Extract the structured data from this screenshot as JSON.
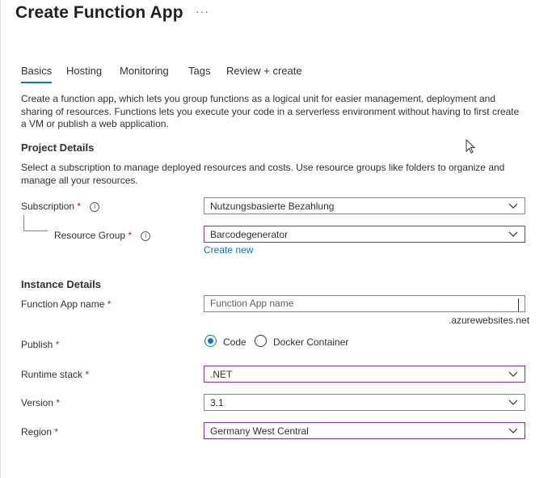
{
  "page": {
    "title": "Create Function App",
    "more": "···"
  },
  "tabs": [
    {
      "label": "Basics",
      "active": true
    },
    {
      "label": "Hosting",
      "active": false
    },
    {
      "label": "Monitoring",
      "active": false
    },
    {
      "label": "Tags",
      "active": false
    },
    {
      "label": "Review + create",
      "active": false
    }
  ],
  "intro": "Create a function app, which lets you group functions as a logical unit for easier management, deployment and sharing of resources. Functions lets you execute your code in a serverless environment without having to first create a VM or publish a web application.",
  "project": {
    "heading": "Project Details",
    "description": "Select a subscription to manage deployed resources and costs. Use resource groups like folders to organize and manage all your resources.",
    "subscription": {
      "label": "Subscription",
      "required": "*",
      "value": "Nutzungsbasierte Bezahlung"
    },
    "resource_group": {
      "label": "Resource Group",
      "required": "*",
      "value": "Barcodegenerator",
      "create_new": "Create new"
    }
  },
  "instance": {
    "heading": "Instance Details",
    "name": {
      "label": "Function App name",
      "required": "*",
      "value": "",
      "placeholder": "Function App name",
      "suffix": ".azurewebsites.net"
    },
    "publish": {
      "label": "Publish",
      "required": "*",
      "options": [
        "Code",
        "Docker Container"
      ],
      "selected": "Code"
    },
    "runtime": {
      "label": "Runtime stack",
      "required": "*",
      "value": ".NET"
    },
    "version": {
      "label": "Version",
      "required": "*",
      "value": "3.1"
    },
    "region": {
      "label": "Region",
      "required": "*",
      "value": "Germany West Central"
    }
  },
  "icons": {
    "info": "info-icon",
    "dropdown": "chevron-down-icon",
    "cursor": "mouse-pointer-icon"
  },
  "colors": {
    "accent": "#0078d4",
    "focus_border": "#8a2da5",
    "required": "#a4262c"
  }
}
